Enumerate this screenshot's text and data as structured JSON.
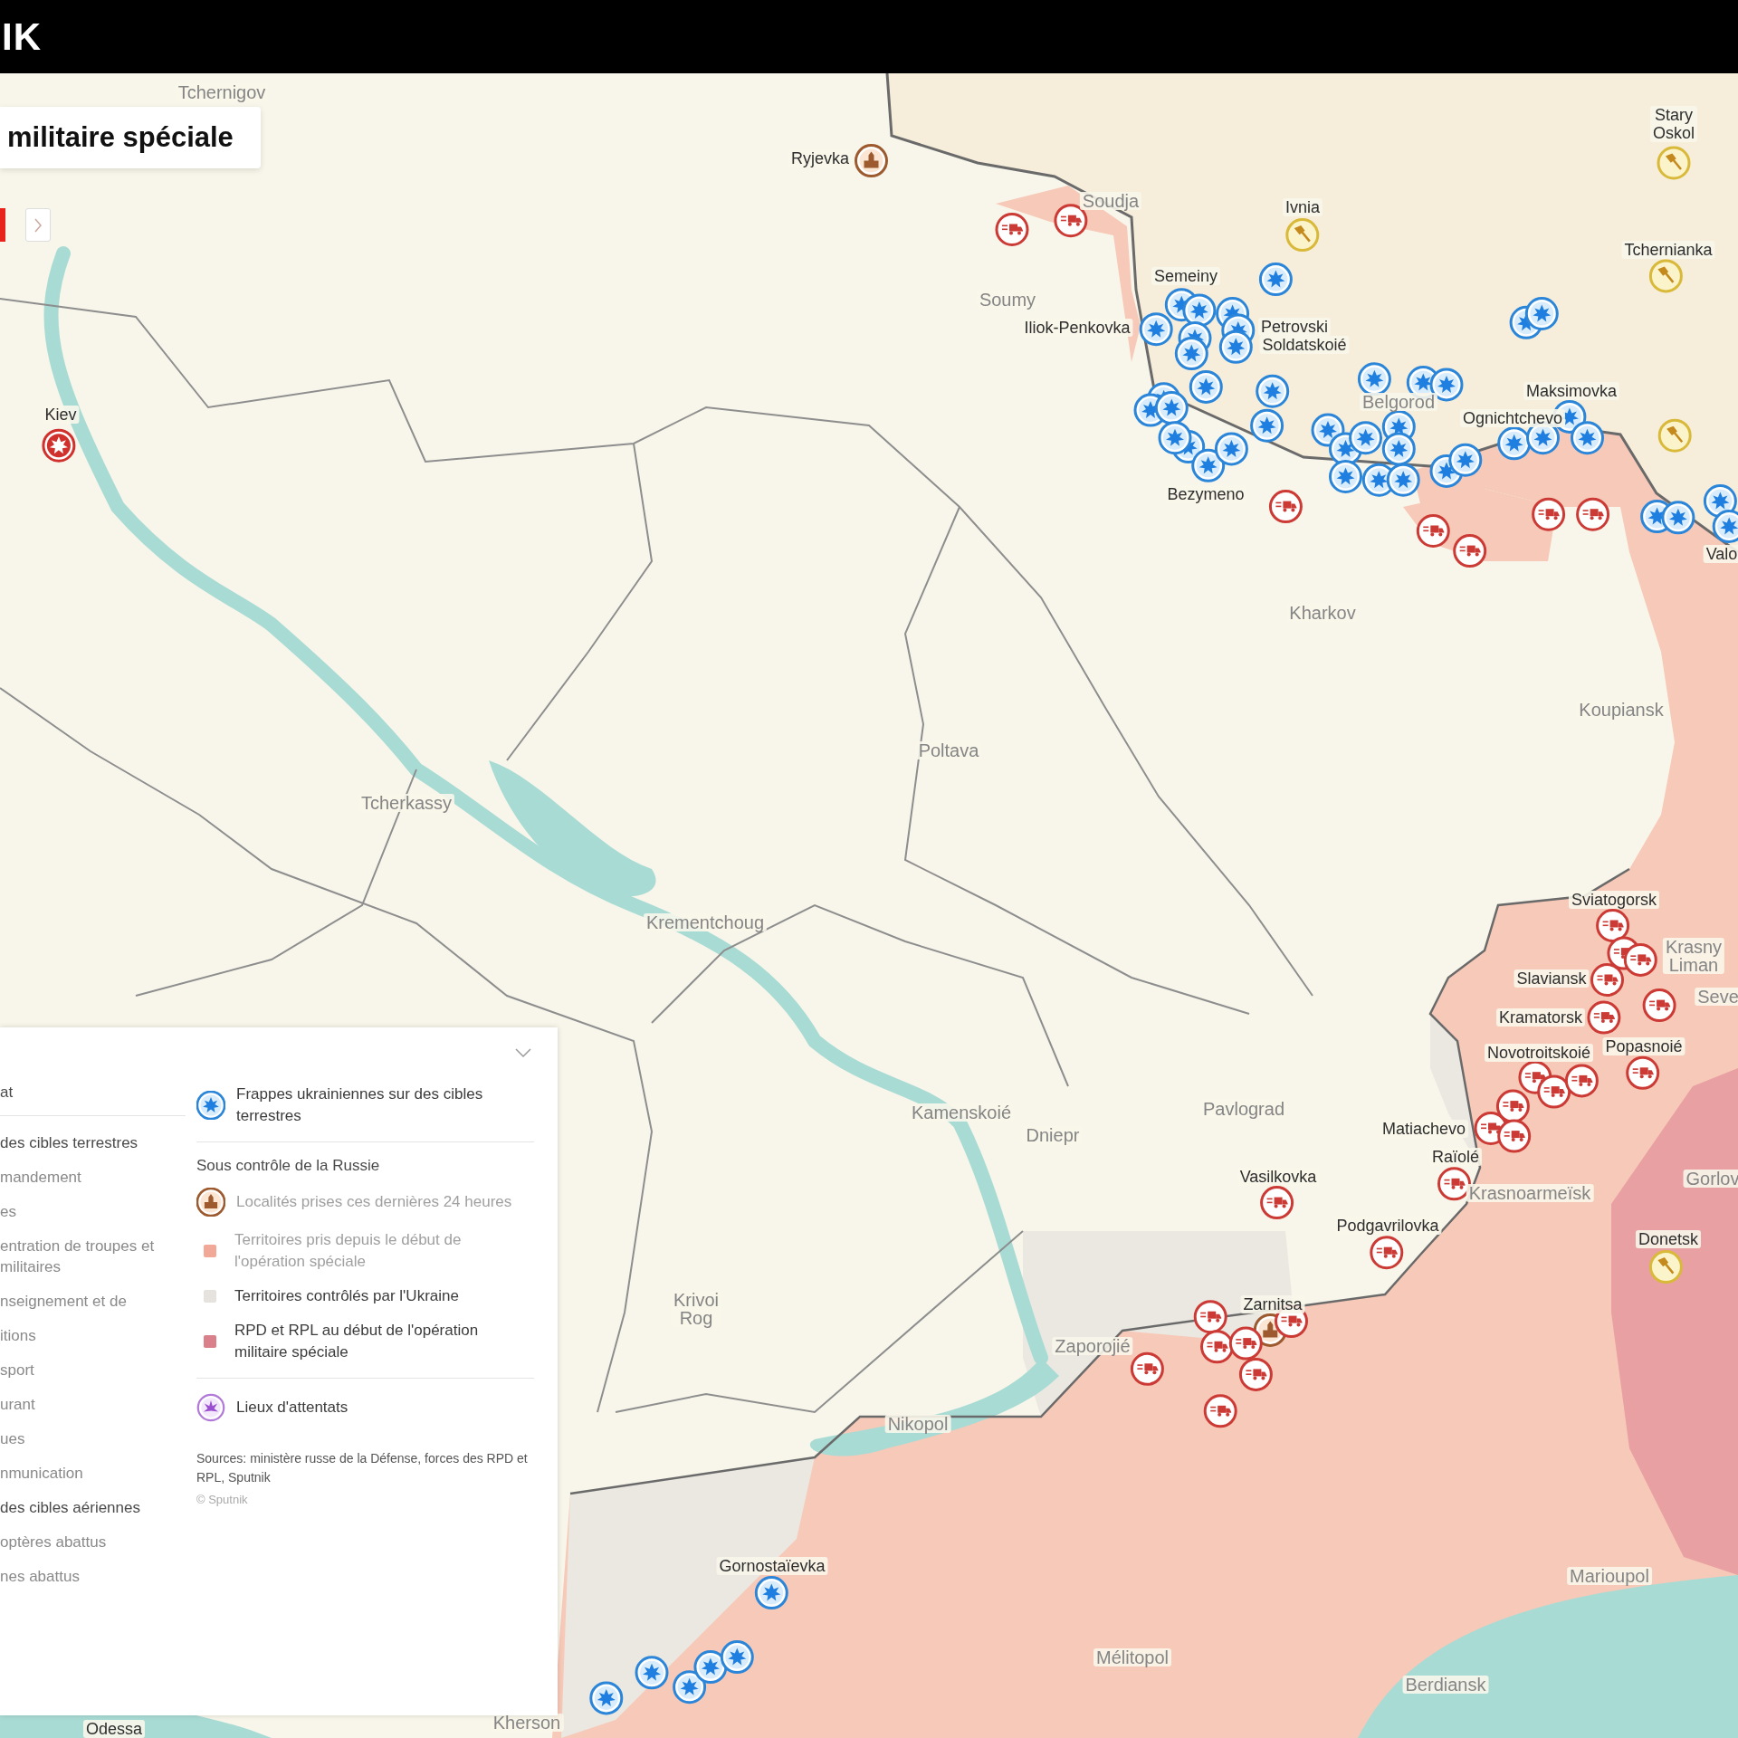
{
  "header": {
    "logo": "IK"
  },
  "title": "militaire spéciale",
  "places": [
    {
      "name": "Tchernigov",
      "kind": "city"
    },
    {
      "name": "Ryjevka",
      "kind": "event"
    },
    {
      "name": "Soudja",
      "kind": "city"
    },
    {
      "name": "Soumy",
      "kind": "city"
    },
    {
      "name": "Ivnia",
      "kind": "event"
    },
    {
      "name": "Stary Oskol",
      "kind": "event"
    },
    {
      "name": "Tchernianka",
      "kind": "event"
    },
    {
      "name": "Semeiny",
      "kind": "event"
    },
    {
      "name": "Iliok-Penkovka",
      "kind": "event"
    },
    {
      "name": "Petrovski",
      "kind": "event"
    },
    {
      "name": "Soldatskoié",
      "kind": "event"
    },
    {
      "name": "Belgorod",
      "kind": "city"
    },
    {
      "name": "Maksimovka",
      "kind": "event"
    },
    {
      "name": "Ognichtchevo",
      "kind": "event"
    },
    {
      "name": "Bezymeno",
      "kind": "event"
    },
    {
      "name": "Valo",
      "kind": "event"
    },
    {
      "name": "Kiev",
      "kind": "event"
    },
    {
      "name": "Kharkov",
      "kind": "city"
    },
    {
      "name": "Koupiansk",
      "kind": "city"
    },
    {
      "name": "Poltava",
      "kind": "city"
    },
    {
      "name": "Tcherkassy",
      "kind": "city"
    },
    {
      "name": "Krementchoug",
      "kind": "city"
    },
    {
      "name": "Sviatogorsk",
      "kind": "event"
    },
    {
      "name": "Krasny Liman",
      "kind": "city"
    },
    {
      "name": "Slaviansk",
      "kind": "event"
    },
    {
      "name": "Seve",
      "kind": "city"
    },
    {
      "name": "Kramatorsk",
      "kind": "event"
    },
    {
      "name": "Novotroitskoié",
      "kind": "event"
    },
    {
      "name": "Popasnoié",
      "kind": "event"
    },
    {
      "name": "Kamenskoié",
      "kind": "city"
    },
    {
      "name": "Dniepr",
      "kind": "city"
    },
    {
      "name": "Pavlograd",
      "kind": "city"
    },
    {
      "name": "Matiachevo",
      "kind": "event"
    },
    {
      "name": "Raïolé",
      "kind": "event"
    },
    {
      "name": "Vasilkovka",
      "kind": "event"
    },
    {
      "name": "Krasnoarmeïsk",
      "kind": "city"
    },
    {
      "name": "Gorlov",
      "kind": "city"
    },
    {
      "name": "Podgavrilovka",
      "kind": "event"
    },
    {
      "name": "Donetsk",
      "kind": "event"
    },
    {
      "name": "Krivoi Rog",
      "kind": "city"
    },
    {
      "name": "Zarnitsa",
      "kind": "event"
    },
    {
      "name": "Zaporojié",
      "kind": "city"
    },
    {
      "name": "Nikopol",
      "kind": "city"
    },
    {
      "name": "Gornostaïevka",
      "kind": "event"
    },
    {
      "name": "Marioupol",
      "kind": "city"
    },
    {
      "name": "Mélitopol",
      "kind": "city"
    },
    {
      "name": "Berdiansk",
      "kind": "city"
    },
    {
      "name": "Kherson",
      "kind": "city"
    },
    {
      "name": "Odessa",
      "kind": "event"
    }
  ],
  "markers": [
    {
      "kind": "building"
    },
    {
      "kind": "building"
    },
    {
      "kind": "alert"
    },
    {
      "kind": "tool"
    },
    {
      "kind": "tool"
    },
    {
      "kind": "tool"
    },
    {
      "kind": "tool"
    },
    {
      "kind": "tool"
    },
    {
      "kind": "truck"
    },
    {
      "kind": "truck"
    },
    {
      "kind": "truck"
    },
    {
      "kind": "truck"
    },
    {
      "kind": "truck"
    },
    {
      "kind": "truck"
    },
    {
      "kind": "truck"
    },
    {
      "kind": "truck"
    },
    {
      "kind": "truck"
    },
    {
      "kind": "truck"
    },
    {
      "kind": "truck"
    },
    {
      "kind": "truck"
    },
    {
      "kind": "truck"
    },
    {
      "kind": "truck"
    },
    {
      "kind": "truck"
    },
    {
      "kind": "truck"
    },
    {
      "kind": "truck"
    },
    {
      "kind": "truck"
    },
    {
      "kind": "truck"
    },
    {
      "kind": "truck"
    },
    {
      "kind": "truck"
    },
    {
      "kind": "truck"
    },
    {
      "kind": "truck"
    },
    {
      "kind": "truck"
    },
    {
      "kind": "truck"
    },
    {
      "kind": "truck"
    },
    {
      "kind": "truck"
    },
    {
      "kind": "truck"
    },
    {
      "kind": "truck"
    },
    {
      "kind": "truck"
    },
    {
      "kind": "strike"
    },
    {
      "kind": "strike"
    },
    {
      "kind": "strike"
    },
    {
      "kind": "strike"
    },
    {
      "kind": "strike"
    },
    {
      "kind": "strike"
    },
    {
      "kind": "strike"
    },
    {
      "kind": "strike"
    },
    {
      "kind": "strike"
    },
    {
      "kind": "strike"
    },
    {
      "kind": "strike"
    },
    {
      "kind": "strike"
    },
    {
      "kind": "strike"
    },
    {
      "kind": "strike"
    },
    {
      "kind": "strike"
    },
    {
      "kind": "strike"
    },
    {
      "kind": "strike"
    },
    {
      "kind": "strike"
    },
    {
      "kind": "strike"
    },
    {
      "kind": "strike"
    },
    {
      "kind": "strike"
    },
    {
      "kind": "strike"
    },
    {
      "kind": "strike"
    },
    {
      "kind": "strike"
    },
    {
      "kind": "strike"
    },
    {
      "kind": "strike"
    },
    {
      "kind": "strike"
    },
    {
      "kind": "strike"
    },
    {
      "kind": "strike"
    },
    {
      "kind": "strike"
    },
    {
      "kind": "strike"
    },
    {
      "kind": "strike"
    },
    {
      "kind": "strike"
    },
    {
      "kind": "strike"
    },
    {
      "kind": "strike"
    },
    {
      "kind": "strike"
    },
    {
      "kind": "strike"
    },
    {
      "kind": "strike"
    },
    {
      "kind": "strike"
    },
    {
      "kind": "strike"
    },
    {
      "kind": "strike"
    },
    {
      "kind": "strike"
    },
    {
      "kind": "strike"
    },
    {
      "kind": "strike"
    },
    {
      "kind": "strike"
    },
    {
      "kind": "strike"
    },
    {
      "kind": "strike"
    },
    {
      "kind": "strike"
    }
  ],
  "legend": {
    "left_groups": [
      {
        "items": [
          {
            "kind": "heading",
            "text": "at"
          }
        ]
      },
      {
        "items": [
          {
            "kind": "heading",
            "text": "des cibles terrestres"
          },
          {
            "kind": "item",
            "text": "mandement"
          },
          {
            "kind": "item",
            "text": "es"
          },
          {
            "kind": "item",
            "text": "entration de troupes et militaires"
          },
          {
            "kind": "item",
            "text": "nseignement et de"
          },
          {
            "kind": "item",
            "text": "itions"
          },
          {
            "kind": "item",
            "text": "sport"
          },
          {
            "kind": "item",
            "text": "urant"
          },
          {
            "kind": "item",
            "text": "ues"
          },
          {
            "kind": "item",
            "text": "nmunication"
          },
          {
            "kind": "heading",
            "text": "des cibles aériennes"
          },
          {
            "kind": "item",
            "text": "optères abattus"
          },
          {
            "kind": "item",
            "text": "nes abattus"
          }
        ]
      }
    ],
    "right_groups": [
      {
        "items": [
          {
            "kind": "strike",
            "text": "Frappes ukrainiennes sur des cibles terrestres",
            "on": true
          }
        ]
      },
      {
        "items": [
          {
            "kind": "heading",
            "text": "Sous contrôle de la Russie"
          },
          {
            "kind": "building",
            "text": "Localités prises ces dernières 24 heures",
            "on": false
          },
          {
            "kind": "swatch",
            "color": "#f2a896",
            "text": "Territoires pris depuis le début de l'opération spéciale",
            "on": false
          },
          {
            "kind": "swatch",
            "color": "#e6e3df",
            "text": "Territoires contrôlés par l'Ukraine",
            "on": true
          },
          {
            "kind": "swatch",
            "color": "#d9808a",
            "text": "RPD et RPL au début de l'opération militaire spéciale",
            "on": true
          }
        ]
      },
      {
        "items": [
          {
            "kind": "attack",
            "text": "Lieux d'attentats",
            "on": true
          }
        ]
      }
    ],
    "sources": "Sources: ministère russe de la Défense, forces des RPD et RPL, Sputnik",
    "copyright": "© Sputnik"
  }
}
